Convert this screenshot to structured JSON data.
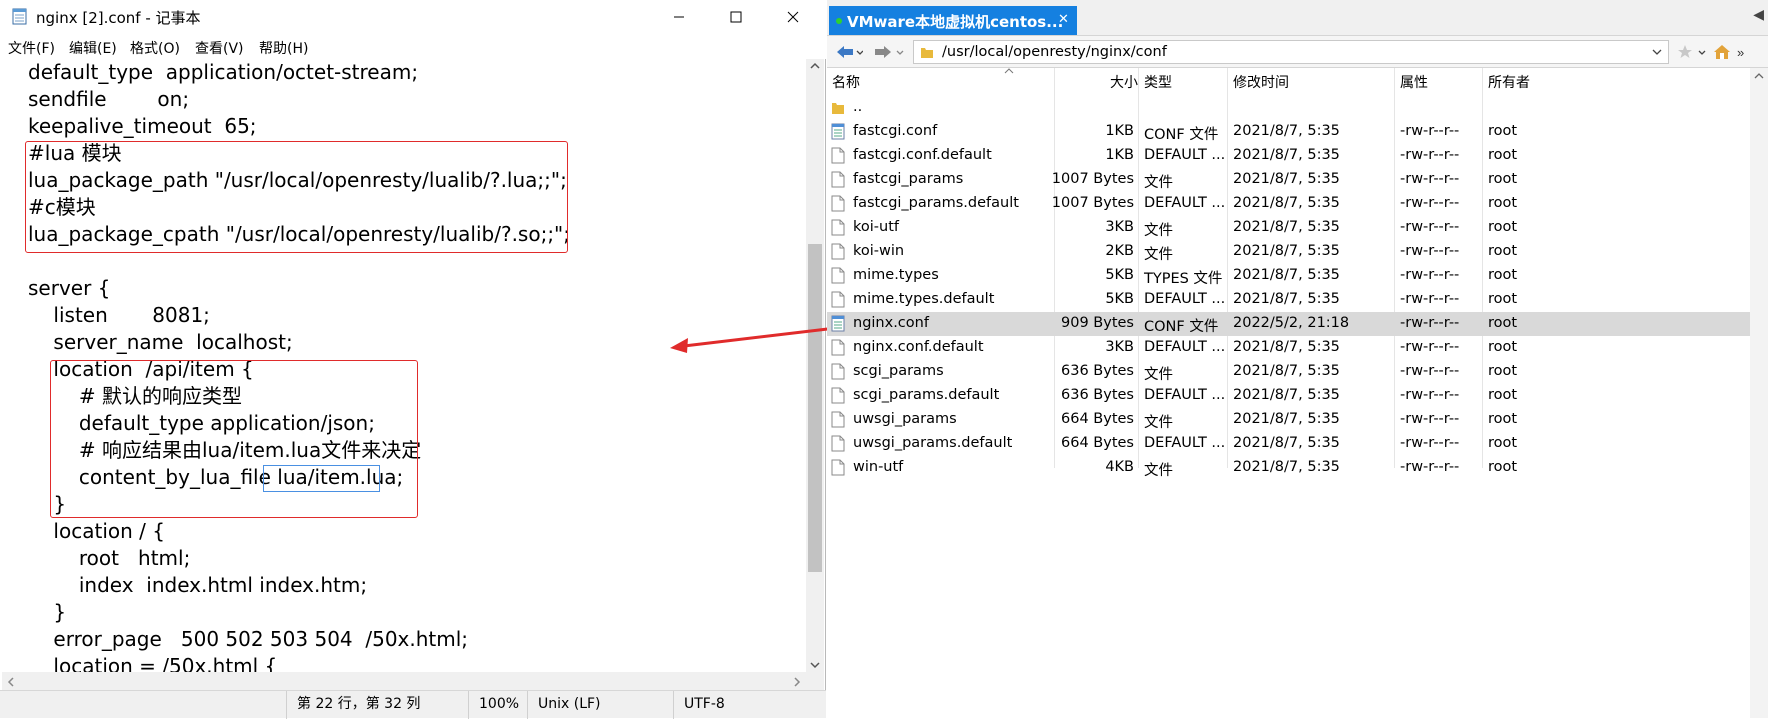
{
  "notepad": {
    "title": "nginx [2].conf - 记事本",
    "menu": [
      "文件(F)",
      "编辑(E)",
      "格式(O)",
      "查看(V)",
      "帮助(H)"
    ],
    "lines": [
      "default_type  application/octet-stream;",
      "sendfile        on;",
      "keepalive_timeout  65;",
      "#lua 模块",
      "lua_package_path \"/usr/local/openresty/lualib/?.lua;;\";",
      "#c模块",
      "lua_package_cpath \"/usr/local/openresty/lualib/?.so;;\";",
      "",
      "server {",
      "    listen       8081;",
      "    server_name  localhost;",
      "    location  /api/item {",
      "        # 默认的响应类型",
      "        default_type application/json;",
      "        # 响应结果由lua/item.lua文件来决定",
      "        content_by_lua_file lua/item.lua;",
      "    }",
      "    location / {",
      "        root   html;",
      "        index  index.html index.htm;",
      "    }",
      "    error_page   500 502 503 504  /50x.html;",
      "    location = /50x.html {"
    ],
    "status": {
      "position": "第 22 行，第 32 列",
      "zoom": "100%",
      "line_ending": "Unix (LF)",
      "encoding": "UTF-8"
    }
  },
  "filemanager": {
    "tab_label": "VMware本地虚拟机centos...",
    "path": "/usr/local/openresty/nginx/conf",
    "columns": {
      "name": "名称",
      "size": "大小",
      "type": "类型",
      "modified": "修改时间",
      "attributes": "属性",
      "owner": "所有者"
    },
    "rows": [
      {
        "name": "..",
        "size": "",
        "type": "",
        "modified": "",
        "attr": "",
        "owner": "",
        "icon": "folder-icon"
      },
      {
        "name": "fastcgi.conf",
        "size": "1KB",
        "type": "CONF 文件",
        "modified": "2021/8/7, 5:35",
        "attr": "-rw-r--r--",
        "owner": "root",
        "icon": "conf-file-icon"
      },
      {
        "name": "fastcgi.conf.default",
        "size": "1KB",
        "type": "DEFAULT ...",
        "modified": "2021/8/7, 5:35",
        "attr": "-rw-r--r--",
        "owner": "root",
        "icon": "file-icon"
      },
      {
        "name": "fastcgi_params",
        "size": "1007 Bytes",
        "type": "文件",
        "modified": "2021/8/7, 5:35",
        "attr": "-rw-r--r--",
        "owner": "root",
        "icon": "file-icon"
      },
      {
        "name": "fastcgi_params.default",
        "size": "1007 Bytes",
        "type": "DEFAULT ...",
        "modified": "2021/8/7, 5:35",
        "attr": "-rw-r--r--",
        "owner": "root",
        "icon": "file-icon"
      },
      {
        "name": "koi-utf",
        "size": "3KB",
        "type": "文件",
        "modified": "2021/8/7, 5:35",
        "attr": "-rw-r--r--",
        "owner": "root",
        "icon": "file-icon"
      },
      {
        "name": "koi-win",
        "size": "2KB",
        "type": "文件",
        "modified": "2021/8/7, 5:35",
        "attr": "-rw-r--r--",
        "owner": "root",
        "icon": "file-icon"
      },
      {
        "name": "mime.types",
        "size": "5KB",
        "type": "TYPES 文件",
        "modified": "2021/8/7, 5:35",
        "attr": "-rw-r--r--",
        "owner": "root",
        "icon": "file-icon"
      },
      {
        "name": "mime.types.default",
        "size": "5KB",
        "type": "DEFAULT ...",
        "modified": "2021/8/7, 5:35",
        "attr": "-rw-r--r--",
        "owner": "root",
        "icon": "file-icon"
      },
      {
        "name": "nginx.conf",
        "size": "909 Bytes",
        "type": "CONF 文件",
        "modified": "2022/5/2, 21:18",
        "attr": "-rw-r--r--",
        "owner": "root",
        "icon": "conf-file-icon"
      },
      {
        "name": "nginx.conf.default",
        "size": "3KB",
        "type": "DEFAULT ...",
        "modified": "2021/8/7, 5:35",
        "attr": "-rw-r--r--",
        "owner": "root",
        "icon": "file-icon"
      },
      {
        "name": "scgi_params",
        "size": "636 Bytes",
        "type": "文件",
        "modified": "2021/8/7, 5:35",
        "attr": "-rw-r--r--",
        "owner": "root",
        "icon": "file-icon"
      },
      {
        "name": "scgi_params.default",
        "size": "636 Bytes",
        "type": "DEFAULT ...",
        "modified": "2021/8/7, 5:35",
        "attr": "-rw-r--r--",
        "owner": "root",
        "icon": "file-icon"
      },
      {
        "name": "uwsgi_params",
        "size": "664 Bytes",
        "type": "文件",
        "modified": "2021/8/7, 5:35",
        "attr": "-rw-r--r--",
        "owner": "root",
        "icon": "file-icon"
      },
      {
        "name": "uwsgi_params.default",
        "size": "664 Bytes",
        "type": "DEFAULT ...",
        "modified": "2021/8/7, 5:35",
        "attr": "-rw-r--r--",
        "owner": "root",
        "icon": "file-icon"
      },
      {
        "name": "win-utf",
        "size": "4KB",
        "type": "文件",
        "modified": "2021/8/7, 5:35",
        "attr": "-rw-r--r--",
        "owner": "root",
        "icon": "file-icon"
      }
    ],
    "selected_file": "nginx.conf"
  },
  "colors": {
    "highlight_box": "#e02b2b",
    "selection_box": "#4a90e2",
    "tab_active": "#1580e0",
    "row_selected": "#d9d9d9"
  }
}
